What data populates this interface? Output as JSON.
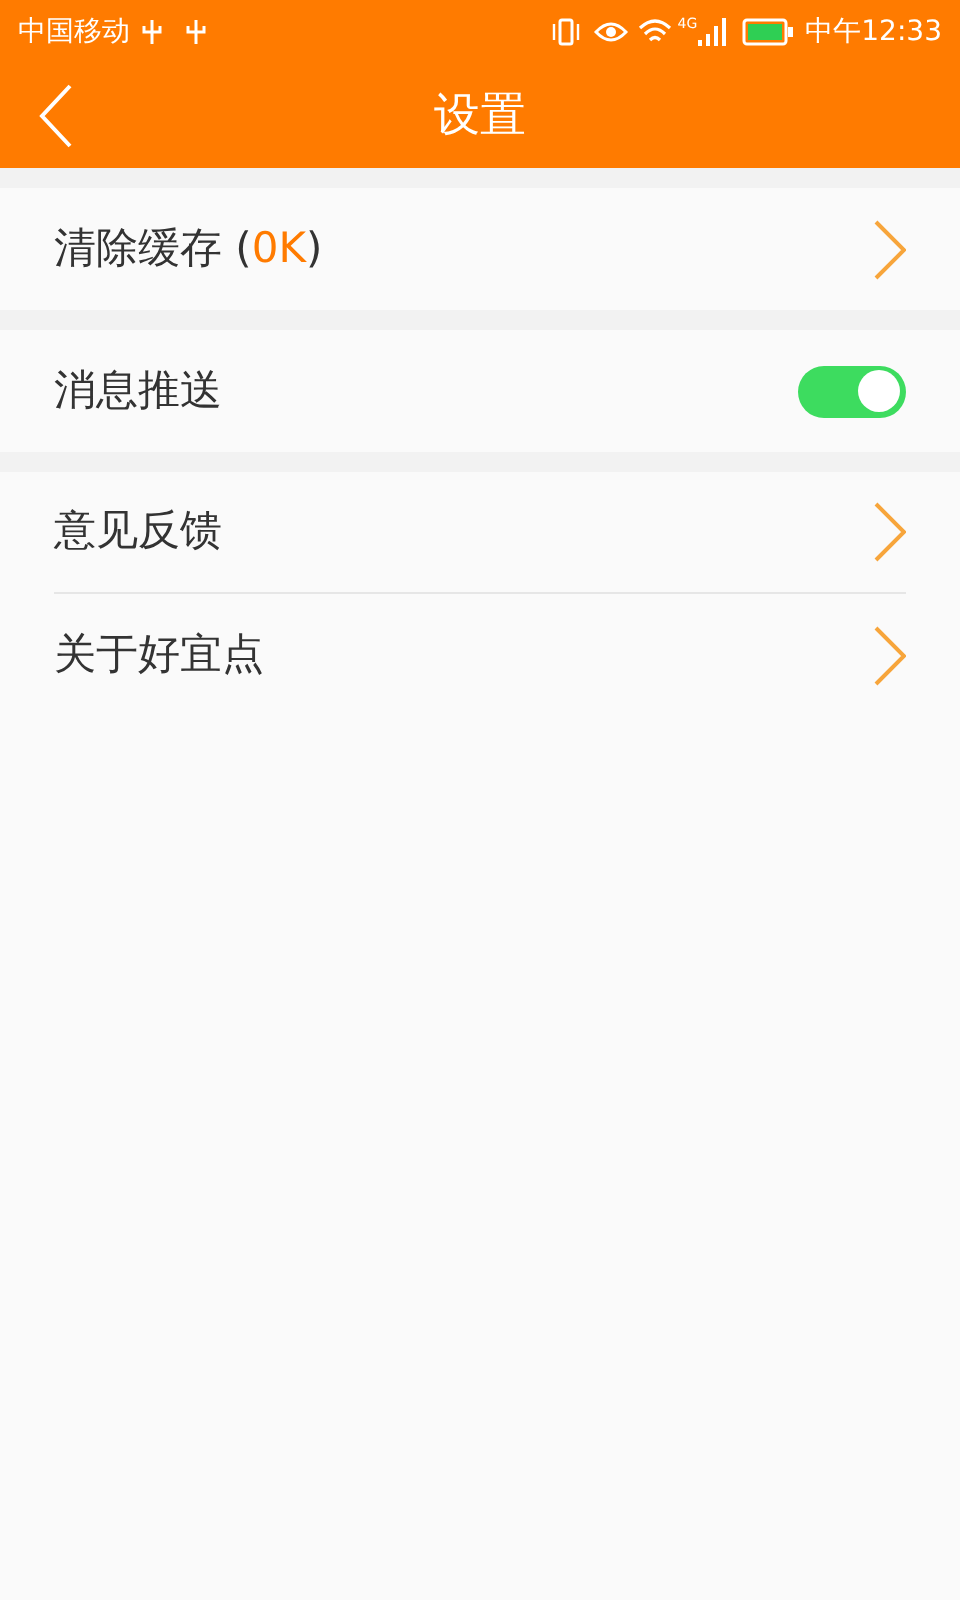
{
  "status_bar": {
    "carrier": "中国移动",
    "network": "4G",
    "time": "中午12:33"
  },
  "header": {
    "title": "设置"
  },
  "groups": [
    {
      "items": [
        {
          "kind": "link",
          "prefix": "清除缓存 (",
          "value": "0K",
          "suffix": ")"
        }
      ]
    },
    {
      "items": [
        {
          "kind": "toggle",
          "label": "消息推送",
          "on": true
        }
      ]
    },
    {
      "items": [
        {
          "kind": "link",
          "label": "意见反馈"
        },
        {
          "kind": "link",
          "label": "关于好宜点"
        }
      ]
    }
  ]
}
